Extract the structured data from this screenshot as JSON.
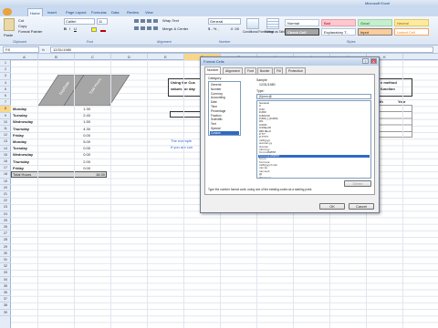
{
  "ribbon": {
    "tabs": [
      "Home",
      "Insert",
      "Page Layout",
      "Formulas",
      "Data",
      "Review",
      "View"
    ],
    "title_right": "Microsoft Excel",
    "font_name": "Calibri",
    "font_size": "11",
    "wrap_text": "Wrap Text",
    "merge_center": "Merge & Center",
    "number_format": "General",
    "cond_format": "Conditional Formatting",
    "format_table": "Format as Table",
    "cut": "Cut",
    "copy": "Copy",
    "format_painter": "Format Painter",
    "paste": "Paste",
    "groups": [
      "Clipboard",
      "Font",
      "Alignment",
      "Number",
      "Styles"
    ],
    "styles": [
      {
        "label": "Normal",
        "bg": "#ffffff",
        "border": "#b6c5da"
      },
      {
        "label": "Bad",
        "bg": "#ffc7ce",
        "border": "#e3a1aa"
      },
      {
        "label": "Good",
        "bg": "#c6efce",
        "border": "#9fd3a8"
      },
      {
        "label": "Neutral",
        "bg": "#ffeb9c",
        "border": "#e0c86a"
      },
      {
        "label": "Check Cell",
        "bg": "#a5a5a5",
        "border": "#3f3f3f"
      },
      {
        "label": "Explanatory T...",
        "bg": "#ffffff",
        "border": "#b6c5da"
      },
      {
        "label": "Input",
        "bg": "#ffcc99",
        "border": "#7f7f7f"
      },
      {
        "label": "Linked Cell",
        "bg": "#ffffff",
        "border": "#f5a463"
      }
    ]
  },
  "formula_bar": {
    "name_box": "F8",
    "fx": "fx",
    "content": "12/31/1980"
  },
  "columns": [
    "A",
    "B",
    "C",
    "D",
    "E",
    "F",
    "G",
    "H",
    "I",
    "J",
    "K"
  ],
  "rows": [
    "1",
    "2",
    "3",
    "4",
    "5",
    "6",
    "7",
    "8",
    "9",
    "10",
    "11",
    "12",
    "13",
    "14",
    "15",
    "16",
    "17",
    "18",
    "19",
    "20",
    "21",
    "22",
    "23",
    "24",
    "25",
    "26",
    "27",
    "28",
    "29",
    "30",
    "31",
    "32",
    "33",
    "34",
    "35",
    "36",
    "37",
    "38",
    "39"
  ],
  "sheet": {
    "header_date": "Day/Date",
    "header_hours": "Total Hours",
    "entries": [
      {
        "day": "Monday",
        "hours": "1.30"
      },
      {
        "day": "Tuesday",
        "hours": "2.40"
      },
      {
        "day": "Wednesday",
        "hours": "1.50"
      },
      {
        "day": "Thursday",
        "hours": "4.30"
      },
      {
        "day": "Friday",
        "hours": "0.00"
      },
      {
        "day": "Monday",
        "hours": "5.00"
      },
      {
        "day": "Tuesday",
        "hours": "0.00"
      },
      {
        "day": "Wednesday",
        "hours": "0.00"
      },
      {
        "day": "Thursday",
        "hours": "2.00"
      },
      {
        "day": "Friday",
        "hours": "0.00"
      }
    ],
    "total_label": "Total Hours",
    "total_value": "16:30",
    "note_line1": "Using the Cus",
    "note_line2": "values for day",
    "method_line1": "e method",
    "method_line2": "function",
    "col_th": "th",
    "col_year": "Year",
    "blue_line1": "The example",
    "blue_line2": "If you are con"
  },
  "dialog": {
    "title": "Format Cells",
    "help": "?",
    "close": "X",
    "tabs": [
      "Number",
      "Alignment",
      "Font",
      "Border",
      "Fill",
      "Protection"
    ],
    "category_label": "Category:",
    "categories": [
      "General",
      "Number",
      "Currency",
      "Accounting",
      "Date",
      "Time",
      "Percentage",
      "Fraction",
      "Scientific",
      "Text",
      "Special",
      "Custom"
    ],
    "selected_category": "Custom",
    "sample_label": "Sample",
    "sample_value": "12/31/1980",
    "type_label": "Type:",
    "type_value": "[h]:mm;@",
    "types": [
      "General",
      "0",
      "0.00",
      "#,##0",
      "#,##0.00",
      "#,##0_);(#,##0)",
      "0%",
      "0.00%",
      "0.00E+00",
      "##0.0E+0",
      "# ?/?",
      "# ??/??",
      "m/d/yyyy",
      "d-mmm-yy",
      "d-mmm",
      "mmm-yy",
      "h:mm AM/PM",
      "h:mm:ss AM/PM",
      "h:mm",
      "h:mm:ss",
      "m/d/yyyy h:mm",
      "mm:ss",
      "mm:ss.0",
      "@",
      "[h]:mm:ss"
    ],
    "selected_type_index": 17,
    "delete_label": "Delete",
    "description": "Type the number format code, using one of the existing codes as a starting point.",
    "ok_label": "OK",
    "cancel_label": "Cancel"
  }
}
